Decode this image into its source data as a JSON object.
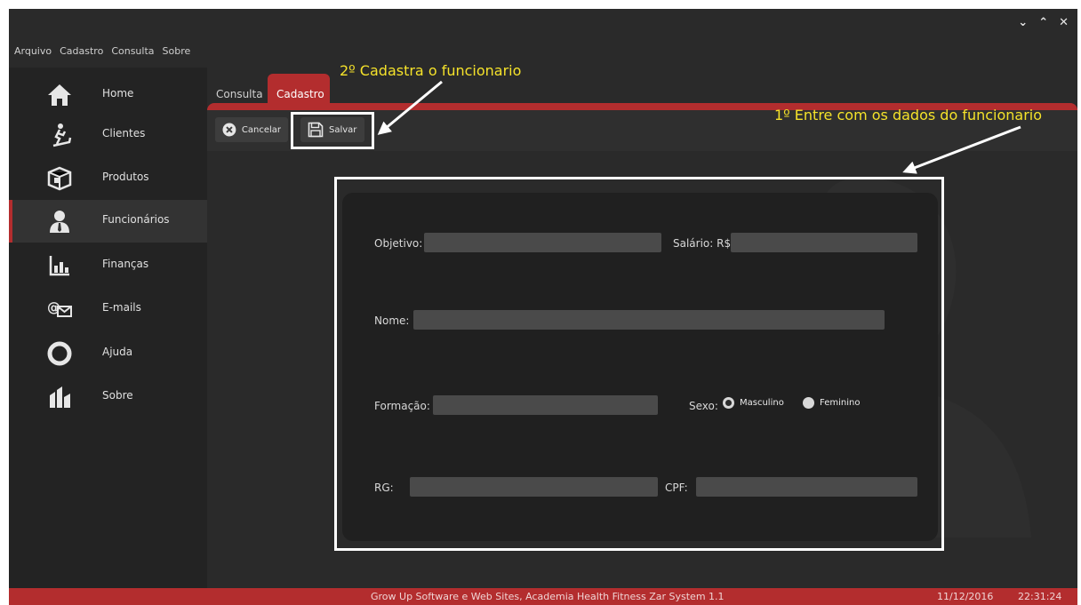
{
  "window": {
    "controls": [
      "⌄",
      "⌃",
      "✕"
    ]
  },
  "menu": [
    "Arquivo",
    "Cadastro",
    "Consulta",
    "Sobre"
  ],
  "sidebar": {
    "items": [
      {
        "label": "Home",
        "icon": "home-icon"
      },
      {
        "label": "Clientes",
        "icon": "treadmill-icon"
      },
      {
        "label": "Produtos",
        "icon": "box-icon"
      },
      {
        "label": "Funcionários",
        "icon": "employee-icon",
        "active": true
      },
      {
        "label": "Finanças",
        "icon": "bar-chart-icon"
      },
      {
        "label": "E-mails",
        "icon": "email-icon"
      },
      {
        "label": "Ajuda",
        "icon": "lifebuoy-icon"
      },
      {
        "label": "Sobre",
        "icon": "about-icon"
      }
    ]
  },
  "tabs": {
    "consulta": "Consulta",
    "cadastro": "Cadastro",
    "active": "Cadastro"
  },
  "toolbar": {
    "cancel": "Cancelar",
    "save": "Salvar"
  },
  "form": {
    "objetivo_label": "Objetivo:",
    "salario_label": "Salário: R$",
    "nome_label": "Nome:",
    "formacao_label": "Formação:",
    "sexo_label": "Sexo:",
    "masculino": "Masculino",
    "feminino": "Feminino",
    "sexo_selected": "Masculino",
    "rg_label": "RG:",
    "cpf_label": "CPF:"
  },
  "annotations": {
    "step2": "2º Cadastra o funcionario",
    "step1": "1º Entre com os dados do funcionario"
  },
  "status": {
    "app": "Grow Up Software e Web Sites, Academia Health Fitness Zar System 1.1",
    "date": "11/12/2016",
    "time": "22:31:24"
  },
  "colors": {
    "accent": "#b32d2e",
    "annotation_text": "#f5e22a"
  }
}
